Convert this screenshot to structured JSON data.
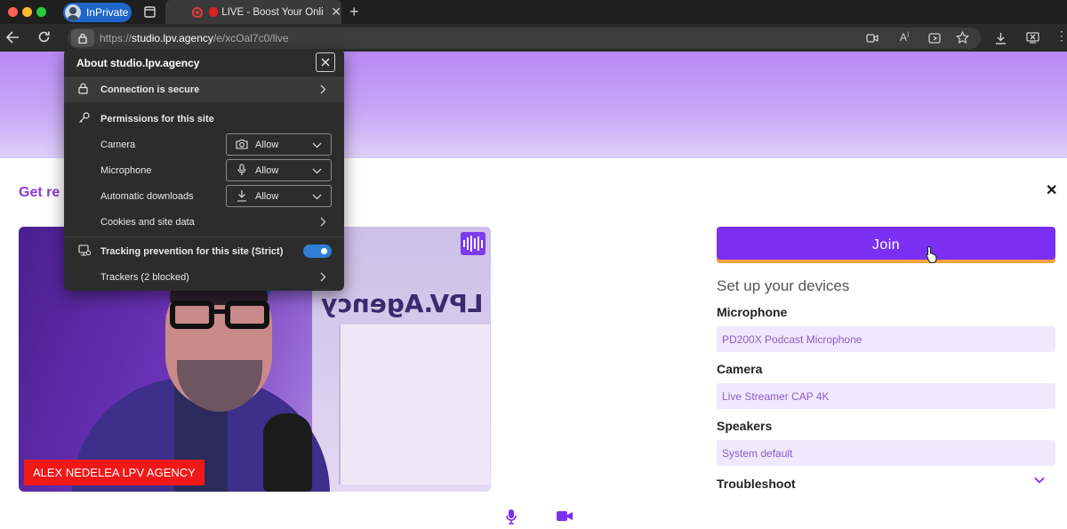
{
  "browser": {
    "inprivate_label": "InPrivate",
    "tab_title": "LIVE - Boost Your Online",
    "url_scheme": "https://",
    "url_host": "studio.lpv.agency",
    "url_path": "/e/xcOal7c0/live"
  },
  "site_info": {
    "title": "About studio.lpv.agency",
    "connection": "Connection is secure",
    "permissions_header": "Permissions for this site",
    "permissions": [
      {
        "label": "Camera",
        "value": "Allow",
        "icon": "camera-icon"
      },
      {
        "label": "Microphone",
        "value": "Allow",
        "icon": "microphone-icon"
      },
      {
        "label": "Automatic downloads",
        "value": "Allow",
        "icon": "download-icon"
      }
    ],
    "cookies": "Cookies and site data",
    "tracking": "Tracking prevention for this site (Strict)",
    "tracking_enabled": true,
    "trackers": "Trackers (2 blocked)"
  },
  "page": {
    "heading_partial": "Get re",
    "name_tag": "ALEX NEDELEA LPV AGENCY",
    "logo_text": "LPV.Agency",
    "join_label": "Join",
    "setup_title": "Set up your devices",
    "microphone_label": "Microphone",
    "microphone_value": "PD200X Podcast Microphone",
    "camera_label": "Camera",
    "camera_value": "Live Streamer CAP 4K",
    "speakers_label": "Speakers",
    "speakers_value": "System default",
    "troubleshoot_label": "Troubleshoot"
  },
  "colors": {
    "accent": "#7b2ff2",
    "banner": "#c8a6f6",
    "name_tag": "#f21818",
    "field_bg": "#f1e8fd"
  }
}
